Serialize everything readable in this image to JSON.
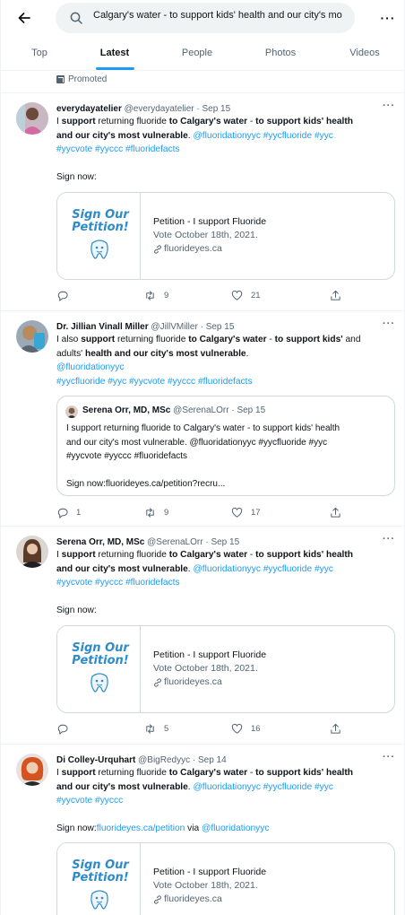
{
  "header": {
    "search_value": "Calgary's water - to support kids' health and our city's mo"
  },
  "tabs": [
    {
      "label": "Top",
      "active": false
    },
    {
      "label": "Latest",
      "active": true
    },
    {
      "label": "People",
      "active": false
    },
    {
      "label": "Photos",
      "active": false
    },
    {
      "label": "Videos",
      "active": false
    }
  ],
  "promoted_label": "Promoted",
  "colors": {
    "accent": "#1d9bf0",
    "muted": "#536471",
    "border": "#cfd9de"
  },
  "tweets": [
    {
      "name": "everydayatelier",
      "handle": "@everydayatelier",
      "date": "Sep 15",
      "text_lines": [
        [
          {
            "t": "I "
          },
          {
            "t": "support",
            "b": true
          },
          {
            "t": " returning fluoride "
          },
          {
            "t": "to Calgary's water",
            "b": true
          },
          {
            "t": " - "
          },
          {
            "t": "to support kids' health",
            "b": true
          }
        ],
        [
          {
            "t": "and our city's most vulnerable",
            "b": true
          },
          {
            "t": ". "
          },
          {
            "t": "@fluoridationyyc #yycfluoride #yyc",
            "l": true
          }
        ],
        [
          {
            "t": "#yycvote #yyccc #fluoridefacts",
            "l": true
          }
        ],
        [
          {
            "t": ""
          }
        ],
        [
          {
            "t": "Sign now:"
          }
        ]
      ],
      "card": {
        "image_text": "Sign Our Petition!",
        "title": "Petition - I support Fluoride",
        "desc": "Vote October 18th, 2021.",
        "domain": "fluorideyes.ca"
      },
      "actions": {
        "replies": "",
        "retweets": "9",
        "likes": "21"
      }
    },
    {
      "name": "Dr. Jillian Vinall Miller",
      "handle": "@JillVMiller",
      "date": "Sep 15",
      "text_lines": [
        [
          {
            "t": "I also "
          },
          {
            "t": "support",
            "b": true
          },
          {
            "t": " returning fluoride "
          },
          {
            "t": "to Calgary's water",
            "b": true
          },
          {
            "t": " - "
          },
          {
            "t": "to support kids'",
            "b": true
          },
          {
            "t": " and"
          }
        ],
        [
          {
            "t": "adults' "
          },
          {
            "t": "health and our city's most vulnerable",
            "b": true
          },
          {
            "t": "."
          }
        ],
        [
          {
            "t": "@fluoridationyyc",
            "l": true
          }
        ],
        [
          {
            "t": " #yycfluoride #yyc #yycvote #yyccc #fluoridefacts",
            "l": true
          }
        ]
      ],
      "quote": {
        "name": "Serena Orr, MD, MSc",
        "handle": "@SerenaLOrr",
        "date": "Sep 15",
        "lines": [
          "I support returning fluoride to Calgary's water - to support kids' health",
          "and our city's most vulnerable. @fluoridationyyc #yycfluoride #yyc",
          "#yycvote #yyccc #fluoridefacts",
          "",
          "Sign now:fluorideyes.ca/petition?recru..."
        ]
      },
      "actions": {
        "replies": "1",
        "retweets": "9",
        "likes": "17"
      }
    },
    {
      "name": "Serena Orr, MD, MSc",
      "handle": "@SerenaLOrr",
      "date": "Sep 15",
      "text_lines": [
        [
          {
            "t": "I "
          },
          {
            "t": "support",
            "b": true
          },
          {
            "t": " returning fluoride "
          },
          {
            "t": "to Calgary's water",
            "b": true
          },
          {
            "t": " - "
          },
          {
            "t": "to support kids' health",
            "b": true
          }
        ],
        [
          {
            "t": "and our city's most vulnerable",
            "b": true
          },
          {
            "t": ". "
          },
          {
            "t": "@fluoridationyyc #yycfluoride #yyc",
            "l": true
          }
        ],
        [
          {
            "t": "#yycvote #yyccc #fluoridefacts",
            "l": true
          }
        ],
        [
          {
            "t": ""
          }
        ],
        [
          {
            "t": "Sign now:"
          }
        ]
      ],
      "card": {
        "image_text": "Sign Our Petition!",
        "title": "Petition - I support Fluoride",
        "desc": "Vote October 18th, 2021.",
        "domain": "fluorideyes.ca"
      },
      "actions": {
        "replies": "",
        "retweets": "5",
        "likes": "16"
      }
    },
    {
      "name": "Di Colley-Urquhart",
      "handle": "@BigRedyyc",
      "date": "Sep 14",
      "text_lines": [
        [
          {
            "t": "I "
          },
          {
            "t": "support",
            "b": true
          },
          {
            "t": " returning fluoride "
          },
          {
            "t": "to Calgary's water",
            "b": true
          },
          {
            "t": " - "
          },
          {
            "t": "to support kids' health",
            "b": true
          }
        ],
        [
          {
            "t": "and our city's most vulnerable",
            "b": true
          },
          {
            "t": ". "
          },
          {
            "t": "@fluoridationyyc #yycfluoride #yyc",
            "l": true
          }
        ],
        [
          {
            "t": "#yycvote #yyccc",
            "l": true
          }
        ],
        [
          {
            "t": ""
          }
        ],
        [
          {
            "t": "Sign now:"
          },
          {
            "t": "fluorideyes.ca/petition",
            "l": true
          },
          {
            "t": " via "
          },
          {
            "t": "@fluoridationyyc",
            "l": true
          }
        ]
      ],
      "card": {
        "image_text": "Sign Our Petition!",
        "title": "Petition - I support Fluoride",
        "desc": "Vote October 18th, 2021.",
        "domain": "fluorideyes.ca"
      },
      "actions": {
        "replies": "",
        "retweets": "",
        "likes": ""
      }
    }
  ]
}
